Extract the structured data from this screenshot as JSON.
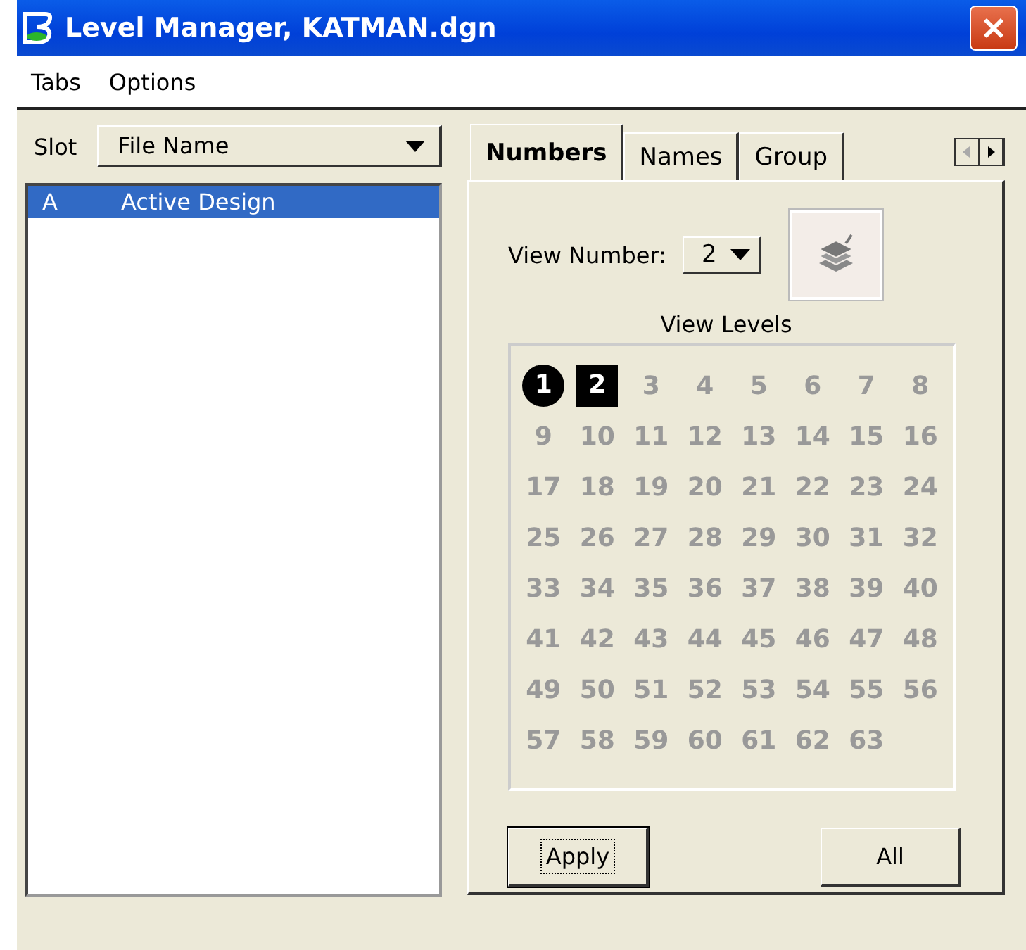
{
  "window": {
    "title": "Level Manager, KATMAN.dgn"
  },
  "menu": [
    "Tabs",
    "Options"
  ],
  "slots": {
    "columns": [
      "Slot",
      "File Name"
    ],
    "rows": [
      {
        "slot": "A",
        "file": "Active Design",
        "selected": true
      }
    ]
  },
  "tabs": [
    {
      "label": "Numbers",
      "selected": true
    },
    {
      "label": "Names",
      "selected": false
    },
    {
      "label": "Group",
      "selected": false
    }
  ],
  "view_number": {
    "label": "View Number:",
    "value": "2"
  },
  "view_levels": {
    "title": "View Levels",
    "levels": [
      {
        "label": "1",
        "kind": "active"
      },
      {
        "label": "2",
        "kind": "selected"
      },
      {
        "label": "3",
        "kind": "off"
      },
      {
        "label": "4",
        "kind": "off"
      },
      {
        "label": "5",
        "kind": "off"
      },
      {
        "label": "6",
        "kind": "off"
      },
      {
        "label": "7",
        "kind": "off"
      },
      {
        "label": "8",
        "kind": "off"
      },
      {
        "label": "9",
        "kind": "off"
      },
      {
        "label": "10",
        "kind": "off"
      },
      {
        "label": "11",
        "kind": "off"
      },
      {
        "label": "12",
        "kind": "off"
      },
      {
        "label": "13",
        "kind": "off"
      },
      {
        "label": "14",
        "kind": "off"
      },
      {
        "label": "15",
        "kind": "off"
      },
      {
        "label": "16",
        "kind": "off"
      },
      {
        "label": "17",
        "kind": "off"
      },
      {
        "label": "18",
        "kind": "off"
      },
      {
        "label": "19",
        "kind": "off"
      },
      {
        "label": "20",
        "kind": "off"
      },
      {
        "label": "21",
        "kind": "off"
      },
      {
        "label": "22",
        "kind": "off"
      },
      {
        "label": "23",
        "kind": "off"
      },
      {
        "label": "24",
        "kind": "off"
      },
      {
        "label": "25",
        "kind": "off"
      },
      {
        "label": "26",
        "kind": "off"
      },
      {
        "label": "27",
        "kind": "off"
      },
      {
        "label": "28",
        "kind": "off"
      },
      {
        "label": "29",
        "kind": "off"
      },
      {
        "label": "30",
        "kind": "off"
      },
      {
        "label": "31",
        "kind": "off"
      },
      {
        "label": "32",
        "kind": "off"
      },
      {
        "label": "33",
        "kind": "off"
      },
      {
        "label": "34",
        "kind": "off"
      },
      {
        "label": "35",
        "kind": "off"
      },
      {
        "label": "36",
        "kind": "off"
      },
      {
        "label": "37",
        "kind": "off"
      },
      {
        "label": "38",
        "kind": "off"
      },
      {
        "label": "39",
        "kind": "off"
      },
      {
        "label": "40",
        "kind": "off"
      },
      {
        "label": "41",
        "kind": "off"
      },
      {
        "label": "42",
        "kind": "off"
      },
      {
        "label": "43",
        "kind": "off"
      },
      {
        "label": "44",
        "kind": "off"
      },
      {
        "label": "45",
        "kind": "off"
      },
      {
        "label": "46",
        "kind": "off"
      },
      {
        "label": "47",
        "kind": "off"
      },
      {
        "label": "48",
        "kind": "off"
      },
      {
        "label": "49",
        "kind": "off"
      },
      {
        "label": "50",
        "kind": "off"
      },
      {
        "label": "51",
        "kind": "off"
      },
      {
        "label": "52",
        "kind": "off"
      },
      {
        "label": "53",
        "kind": "off"
      },
      {
        "label": "54",
        "kind": "off"
      },
      {
        "label": "55",
        "kind": "off"
      },
      {
        "label": "56",
        "kind": "off"
      },
      {
        "label": "57",
        "kind": "off"
      },
      {
        "label": "58",
        "kind": "off"
      },
      {
        "label": "59",
        "kind": "off"
      },
      {
        "label": "60",
        "kind": "off"
      },
      {
        "label": "61",
        "kind": "off"
      },
      {
        "label": "62",
        "kind": "off"
      },
      {
        "label": "63",
        "kind": "off"
      }
    ]
  },
  "buttons": [
    "Apply",
    "All"
  ]
}
